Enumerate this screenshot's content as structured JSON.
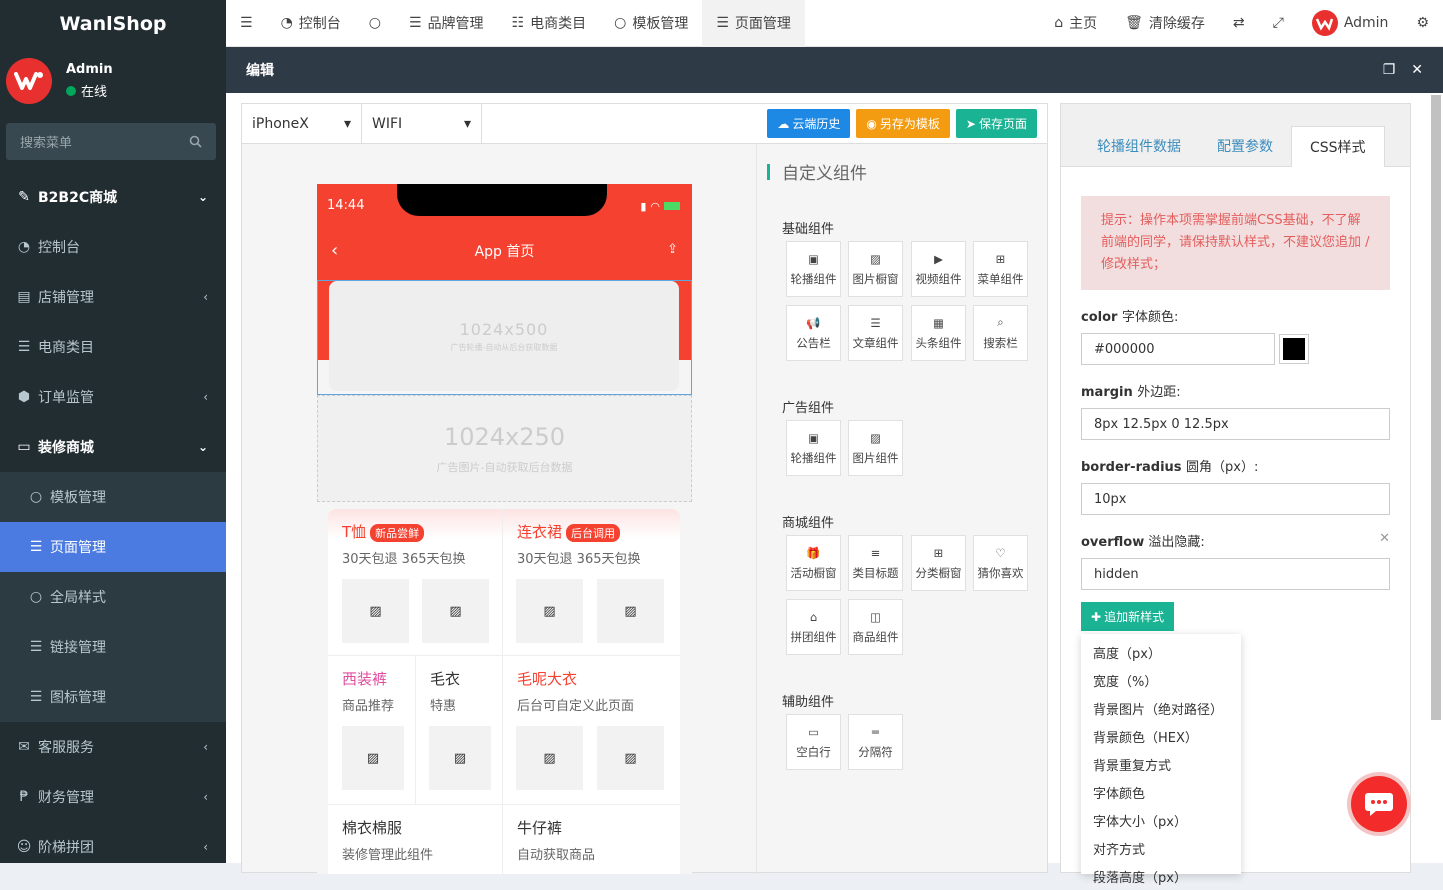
{
  "sidebar": {
    "logo": "WanlShop",
    "user": "Admin",
    "status": "在线",
    "search_placeholder": "搜索菜单",
    "items": [
      {
        "label": "B2B2C商城",
        "icon": "magic-icon",
        "arrow": "⌄"
      },
      {
        "label": "控制台",
        "icon": "dashboard-icon"
      },
      {
        "label": "店铺管理",
        "icon": "archive-icon",
        "arrow": "‹"
      },
      {
        "label": "电商类目",
        "icon": "list-icon"
      },
      {
        "label": "订单监管",
        "icon": "cube-icon",
        "arrow": "‹"
      },
      {
        "label": "装修商城",
        "icon": "desktop-icon",
        "arrow": "⌄"
      },
      {
        "label": "模板管理",
        "icon": "circle-icon"
      },
      {
        "label": "页面管理",
        "icon": "list-icon"
      },
      {
        "label": "全局样式",
        "icon": "circle-icon"
      },
      {
        "label": "链接管理",
        "icon": "list-icon"
      },
      {
        "label": "图标管理",
        "icon": "list-icon"
      },
      {
        "label": "客服服务",
        "icon": "comments-icon",
        "arrow": "‹"
      },
      {
        "label": "财务管理",
        "icon": "paypal-icon",
        "arrow": "‹"
      },
      {
        "label": "阶梯拼团",
        "icon": "users-icon",
        "arrow": "‹"
      }
    ]
  },
  "topbar": {
    "tabs": [
      "控制台",
      "",
      "品牌管理",
      "电商类目",
      "模板管理",
      "页面管理"
    ],
    "home": "主页",
    "clear": "清除缓存",
    "admin": "Admin"
  },
  "editbar": {
    "title": "编辑"
  },
  "toolbar": {
    "device": "iPhoneX",
    "network": "WIFI",
    "btn_history": "云端历史",
    "btn_template": "另存为模板",
    "btn_save": "保存页面"
  },
  "phone": {
    "time": "14:44",
    "title": "App 首页",
    "banner": {
      "size": "1024x500",
      "desc": "广告轮播-自动从后台获取数据"
    },
    "ad": {
      "size": "1024x250",
      "desc": "广告图片-自动获取后台数据"
    },
    "cells": [
      {
        "title": "T恤",
        "tag": "新品尝鲜",
        "sub": "30天包退 365天包换"
      },
      {
        "title": "连衣裙",
        "tag": "后台调用",
        "sub": "30天包退 365天包换"
      },
      {
        "title": "西装裤",
        "sub": "商品推荐"
      },
      {
        "title": "毛衣",
        "sub": "特惠"
      },
      {
        "title": "毛呢大衣",
        "sub": "后台可自定义此页面"
      },
      {
        "title": "棉衣棉服",
        "sub": "装修管理此组件"
      },
      {
        "title": "牛仔裤",
        "sub": "自动获取商品"
      }
    ]
  },
  "components": {
    "title": "自定义组件",
    "groups": [
      {
        "name": "基础组件",
        "items": [
          "轮播组件",
          "图片橱窗",
          "视频组件",
          "菜单组件",
          "公告栏",
          "文章组件",
          "头条组件",
          "搜索栏"
        ]
      },
      {
        "name": "广告组件",
        "items": [
          "轮播组件",
          "图片组件"
        ]
      },
      {
        "name": "商城组件",
        "items": [
          "活动橱窗",
          "类目标题",
          "分类橱窗",
          "猜你喜欢",
          "拼团组件",
          "商品组件"
        ]
      },
      {
        "name": "辅助组件",
        "items": [
          "空白行",
          "分隔符"
        ]
      }
    ]
  },
  "right": {
    "tabs": [
      "轮播组件数据",
      "配置参数",
      "CSS样式"
    ],
    "hint": "提示：操作本项需掌握前端CSS基础，不了解前端的同学，请保持默认样式，不建议您追加 / 修改样式；",
    "fields": [
      {
        "key": "color",
        "label": "字体颜色:",
        "value": "#000000"
      },
      {
        "key": "margin",
        "label": "外边距:",
        "value": "8px 12.5px 0 12.5px"
      },
      {
        "key": "border-radius",
        "label": "圆角（px）:",
        "value": "10px"
      },
      {
        "key": "overflow",
        "label": "溢出隐藏:",
        "value": "hidden"
      }
    ],
    "add_btn": "追加新样式",
    "dropdown": [
      "高度（px）",
      "宽度（%）",
      "背景图片（绝对路径）",
      "背景颜色（HEX）",
      "背景重复方式",
      "字体颜色",
      "字体大小（px）",
      "对齐方式",
      "段落高度（px）"
    ]
  },
  "colors": {
    "accent": "#4b7be0",
    "red": "#f44130",
    "green": "#1ab394",
    "blue": "#1e88e5",
    "orange": "#f39c12"
  }
}
